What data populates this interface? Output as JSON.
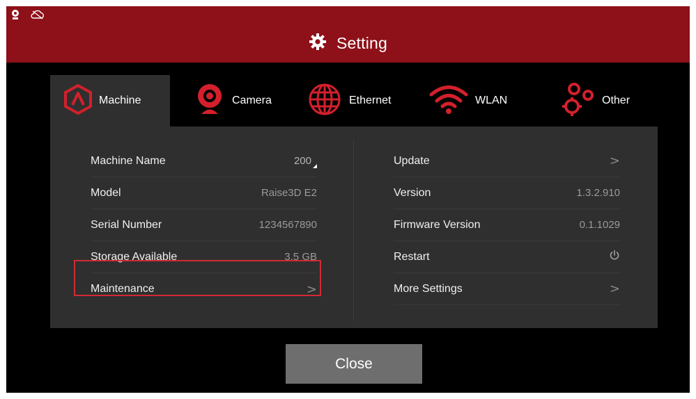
{
  "header": {
    "title": "Setting",
    "icons": [
      "webcam-status-icon",
      "cloud-status-icon",
      "gear-icon"
    ]
  },
  "tabs": [
    {
      "label": "Machine",
      "icon": "machine-logo-icon",
      "active": true
    },
    {
      "label": "Camera",
      "icon": "camera-icon",
      "active": false
    },
    {
      "label": "Ethernet",
      "icon": "globe-icon",
      "active": false
    },
    {
      "label": "WLAN",
      "icon": "wifi-icon",
      "active": false
    },
    {
      "label": "Other",
      "icon": "gears-icon",
      "active": false
    }
  ],
  "left_rows": [
    {
      "label": "Machine Name",
      "value": "200"
    },
    {
      "label": "Model",
      "value": "Raise3D E2"
    },
    {
      "label": "Serial Number",
      "value": "1234567890"
    },
    {
      "label": "Storage Available",
      "value": "3.5 GB"
    },
    {
      "label": "Maintenance",
      "value": ">"
    }
  ],
  "right_rows": [
    {
      "label": "Update",
      "value": ">"
    },
    {
      "label": "Version",
      "value": "1.3.2.910"
    },
    {
      "label": "Firmware Version",
      "value": "0.1.1029"
    },
    {
      "label": "Restart",
      "icon": "power-icon"
    },
    {
      "label": "More Settings",
      "value": ">"
    }
  ],
  "close_label": "Close",
  "colors": {
    "header_red": "#8e1019",
    "accent_red": "#d3202c",
    "panel_bg": "#2f2f2f",
    "highlight_border": "#d02a33",
    "close_button": "#6e6e6e"
  }
}
